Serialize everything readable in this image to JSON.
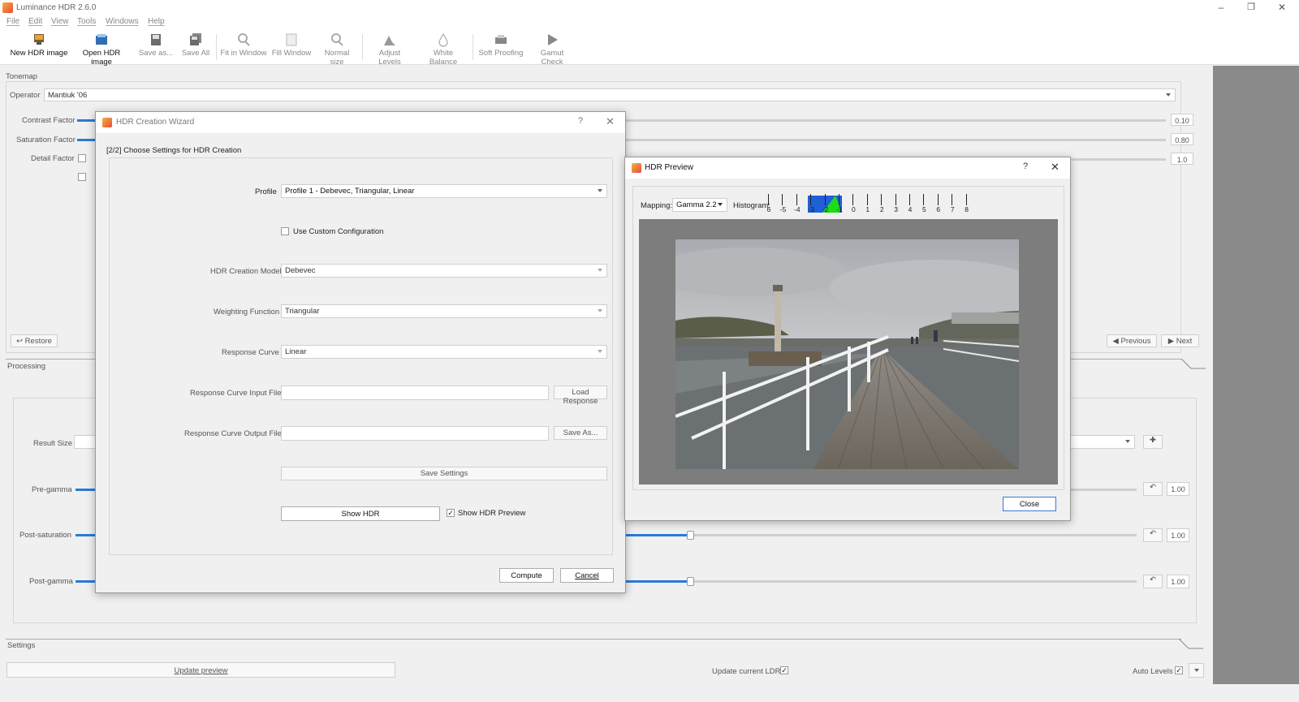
{
  "window": {
    "title": "Luminance HDR 2.6.0"
  },
  "menu": [
    "File",
    "Edit",
    "View",
    "Tools",
    "Windows",
    "Help"
  ],
  "toolbar": [
    {
      "label": "New HDR image",
      "enabled": true,
      "icon": "new-hdr-icon"
    },
    {
      "label": "Open HDR image",
      "enabled": true,
      "icon": "open-hdr-icon"
    },
    {
      "label": "Save as...",
      "enabled": false,
      "icon": "save-as-icon"
    },
    {
      "label": "Save All",
      "enabled": false,
      "icon": "save-all-icon"
    },
    {
      "label": "Fit in Window",
      "enabled": false,
      "icon": "zoom-fit-icon"
    },
    {
      "label": "Fill Window",
      "enabled": false,
      "icon": "fill-window-icon"
    },
    {
      "label": "Normal size",
      "enabled": false,
      "icon": "zoom-normal-icon"
    },
    {
      "label": "Adjust Levels",
      "enabled": false,
      "icon": "levels-icon"
    },
    {
      "label": "White Balance",
      "enabled": false,
      "icon": "white-balance-icon"
    },
    {
      "label": "Soft Proofing",
      "enabled": false,
      "icon": "soft-proofing-icon"
    },
    {
      "label": "Gamut Check",
      "enabled": false,
      "icon": "gamut-check-icon"
    }
  ],
  "tonemap": {
    "section_label": "Tonemap",
    "operator_label": "Operator",
    "operator_value": "Mantiuk '06",
    "contrast_label": "Contrast Factor",
    "contrast_value": "0.10",
    "saturation_label": "Saturation Factor",
    "saturation_value": "0.80",
    "detail_label": "Detail Factor",
    "detail_value": "1.0",
    "restore_label": "Restore",
    "previous_label": "Previous",
    "next_label": "Next"
  },
  "processing": {
    "section_label": "Processing",
    "result_size_label": "Result Size",
    "pregamma_label": "Pre-gamma",
    "pregamma_value": "1.00",
    "postsat_label": "Post-saturation",
    "postsat_value": "1.00",
    "postgamma_label": "Post-gamma",
    "postgamma_value": "1.00"
  },
  "settings": {
    "section_label": "Settings",
    "update_preview_label": "Update preview",
    "update_ldr_label": "Update current LDR",
    "auto_levels_label": "Auto Levels"
  },
  "wizard": {
    "title": "HDR Creation Wizard",
    "help": "?",
    "step_label": "[2/2] Choose Settings for HDR Creation",
    "profile_label": "Profile",
    "profile_value": "Profile 1 - Debevec, Triangular, Linear",
    "custom_config_label": "Use Custom Configuration",
    "model_label": "HDR Creation Model",
    "model_value": "Debevec",
    "weighting_label": "Weighting Function",
    "weighting_value": "Triangular",
    "response_label": "Response Curve",
    "response_value": "Linear",
    "input_file_label": "Response Curve Input File",
    "load_response_label": "Load Response",
    "output_file_label": "Response Curve Output File",
    "save_as_label": "Save As...",
    "save_settings_label": "Save Settings",
    "show_hdr_label": "Show HDR",
    "show_preview_label": "Show HDR Preview",
    "compute_label": "Compute",
    "cancel_label": "Cancel"
  },
  "preview": {
    "title": "HDR Preview",
    "help": "?",
    "mapping_label": "Mapping:",
    "mapping_value": "Gamma 2.2",
    "histogram_label": "Histogram:",
    "histogram_ticks": [
      "6",
      "-5",
      "-4",
      "-3",
      "-2",
      "-1",
      "0",
      "1",
      "2",
      "3",
      "4",
      "5",
      "6",
      "7",
      "8"
    ],
    "close_label": "Close"
  }
}
